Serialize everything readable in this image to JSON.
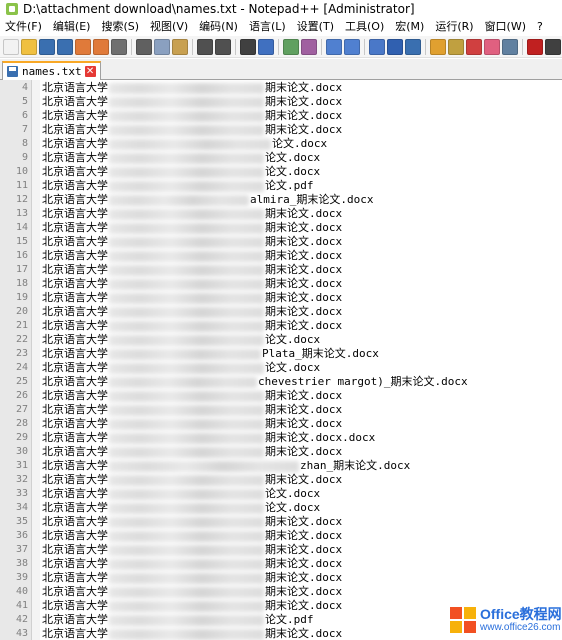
{
  "window": {
    "title": "D:\\attachment download\\names.txt - Notepad++ [Administrator]"
  },
  "menu": [
    {
      "label": "文件(F)"
    },
    {
      "label": "编辑(E)"
    },
    {
      "label": "搜索(S)"
    },
    {
      "label": "视图(V)"
    },
    {
      "label": "编码(N)"
    },
    {
      "label": "语言(L)"
    },
    {
      "label": "设置(T)"
    },
    {
      "label": "工具(O)"
    },
    {
      "label": "宏(M)"
    },
    {
      "label": "运行(R)"
    },
    {
      "label": "窗口(W)"
    },
    {
      "label": "?"
    }
  ],
  "toolbar": {
    "buttons": [
      {
        "icon": "new-file-icon",
        "color": "#f2f2f2"
      },
      {
        "icon": "open-file-icon",
        "color": "#f0c040"
      },
      {
        "icon": "save-icon",
        "color": "#3a6fb0"
      },
      {
        "icon": "save-all-icon",
        "color": "#3a6fb0"
      },
      {
        "icon": "close-icon",
        "color": "#e07a3a"
      },
      {
        "icon": "close-all-icon",
        "color": "#e07a3a"
      },
      {
        "icon": "print-icon",
        "color": "#707070"
      },
      {
        "icon": "cut-icon",
        "color": "#606060"
      },
      {
        "icon": "copy-icon",
        "color": "#8aa0c0"
      },
      {
        "icon": "paste-icon",
        "color": "#c8a050"
      },
      {
        "icon": "undo-icon",
        "color": "#505050"
      },
      {
        "icon": "redo-icon",
        "color": "#505050"
      },
      {
        "icon": "find-icon",
        "color": "#404040"
      },
      {
        "icon": "replace-icon",
        "color": "#4070c0"
      },
      {
        "icon": "zoom-in-icon",
        "color": "#60a060"
      },
      {
        "icon": "zoom-out-icon",
        "color": "#a060a0"
      },
      {
        "icon": "sync-vertical-icon",
        "color": "#5080d0"
      },
      {
        "icon": "sync-horizontal-icon",
        "color": "#5080d0"
      },
      {
        "icon": "word-wrap-icon",
        "color": "#4a78c8"
      },
      {
        "icon": "show-all-chars-icon",
        "color": "#3060b0"
      },
      {
        "icon": "indent-guide-icon",
        "color": "#3a6fb0"
      },
      {
        "icon": "udl-icon",
        "color": "#e0a030"
      },
      {
        "icon": "doc-map-icon",
        "color": "#c0a040"
      },
      {
        "icon": "function-list-icon",
        "color": "#d04040"
      },
      {
        "icon": "folder-workspace-icon",
        "color": "#e06080"
      },
      {
        "icon": "monitoring-icon",
        "color": "#6080a0"
      },
      {
        "icon": "record-macro-icon",
        "color": "#c02020"
      },
      {
        "icon": "stop-record-icon",
        "color": "#404040"
      }
    ]
  },
  "tab": {
    "label": "names.txt",
    "close": "✕"
  },
  "editor": {
    "lines": [
      {
        "n": "4",
        "pre": "北京语言大学",
        "blur": 155,
        "post": "期末论文.docx"
      },
      {
        "n": "5",
        "pre": "北京语言大学",
        "blur": 155,
        "post": "期末论文.docx"
      },
      {
        "n": "6",
        "pre": "北京语言大学",
        "blur": 155,
        "post": "期末论文.docx"
      },
      {
        "n": "7",
        "pre": "北京语言大学",
        "blur": 155,
        "post": "期末论文.docx"
      },
      {
        "n": "8",
        "pre": "北京语言大学",
        "blur": 162,
        "post": "论文.docx"
      },
      {
        "n": "9",
        "pre": "北京语言大学",
        "blur": 155,
        "post": "论文.docx"
      },
      {
        "n": "10",
        "pre": "北京语言大学",
        "blur": 155,
        "post": "论文.docx"
      },
      {
        "n": "11",
        "pre": "北京语言大学",
        "blur": 155,
        "post": "论文.pdf"
      },
      {
        "n": "12",
        "pre": "北京语言大学",
        "blur": 140,
        "post": "almira_期末论文.docx"
      },
      {
        "n": "13",
        "pre": "北京语言大学",
        "blur": 155,
        "post": "期末论文.docx"
      },
      {
        "n": "14",
        "pre": "北京语言大学",
        "blur": 155,
        "post": "期末论文.docx"
      },
      {
        "n": "15",
        "pre": "北京语言大学",
        "blur": 155,
        "post": "期末论文.docx"
      },
      {
        "n": "16",
        "pre": "北京语言大学",
        "blur": 155,
        "post": "期末论文.docx"
      },
      {
        "n": "17",
        "pre": "北京语言大学",
        "blur": 155,
        "post": "期末论文.docx"
      },
      {
        "n": "18",
        "pre": "北京语言大学",
        "blur": 155,
        "post": "期末论文.docx"
      },
      {
        "n": "19",
        "pre": "北京语言大学",
        "blur": 155,
        "post": "期末论文.docx"
      },
      {
        "n": "20",
        "pre": "北京语言大学",
        "blur": 155,
        "post": "期末论文.docx"
      },
      {
        "n": "21",
        "pre": "北京语言大学",
        "blur": 155,
        "post": "期末论文.docx"
      },
      {
        "n": "22",
        "pre": "北京语言大学",
        "blur": 155,
        "post": "论文.docx"
      },
      {
        "n": "23",
        "pre": "北京语言大学",
        "blur": 152,
        "post": "Plata_期末论文.docx"
      },
      {
        "n": "24",
        "pre": "北京语言大学",
        "blur": 155,
        "post": "论文.docx"
      },
      {
        "n": "25",
        "pre": "北京语言大学",
        "blur": 148,
        "post": "chevestrier margot)_期末论文.docx"
      },
      {
        "n": "26",
        "pre": "北京语言大学",
        "blur": 155,
        "post": "期末论文.docx"
      },
      {
        "n": "27",
        "pre": "北京语言大学",
        "blur": 155,
        "post": "期末论文.docx"
      },
      {
        "n": "28",
        "pre": "北京语言大学",
        "blur": 155,
        "post": "期末论文.docx"
      },
      {
        "n": "29",
        "pre": "北京语言大学",
        "blur": 155,
        "post": "期末论文.docx.docx"
      },
      {
        "n": "30",
        "pre": "北京语言大学",
        "blur": 155,
        "post": "期末论文.docx"
      },
      {
        "n": "31",
        "pre": "北京语言大学",
        "blur": 190,
        "post": "zhan_期末论文.docx"
      },
      {
        "n": "32",
        "pre": "北京语言大学",
        "blur": 155,
        "post": "期末论文.docx"
      },
      {
        "n": "33",
        "pre": "北京语言大学",
        "blur": 155,
        "post": "论文.docx"
      },
      {
        "n": "34",
        "pre": "北京语言大学",
        "blur": 155,
        "post": "论文.docx"
      },
      {
        "n": "35",
        "pre": "北京语言大学",
        "blur": 155,
        "post": "期末论文.docx"
      },
      {
        "n": "36",
        "pre": "北京语言大学",
        "blur": 155,
        "post": "期末论文.docx"
      },
      {
        "n": "37",
        "pre": "北京语言大学",
        "blur": 155,
        "post": "期末论文.docx"
      },
      {
        "n": "38",
        "pre": "北京语言大学",
        "blur": 155,
        "post": "期末论文.docx"
      },
      {
        "n": "39",
        "pre": "北京语言大学",
        "blur": 155,
        "post": "期末论文.docx"
      },
      {
        "n": "40",
        "pre": "北京语言大学",
        "blur": 155,
        "post": "期末论文.docx"
      },
      {
        "n": "41",
        "pre": "北京语言大学",
        "blur": 155,
        "post": "期末论文.docx"
      },
      {
        "n": "42",
        "pre": "北京语言大学",
        "blur": 155,
        "post": "论文.pdf"
      },
      {
        "n": "43",
        "pre": "北京语言大学",
        "blur": 155,
        "post": "期末论文.docx"
      }
    ]
  },
  "watermark": {
    "brand": "Office教程网",
    "url": "www.office26.com"
  }
}
